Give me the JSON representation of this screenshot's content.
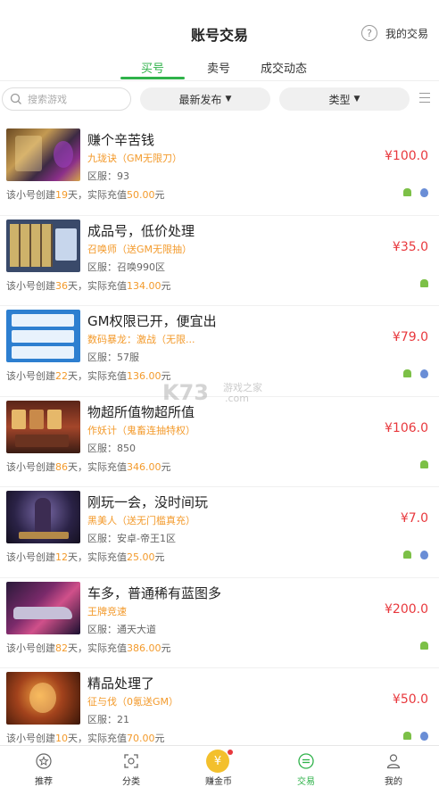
{
  "header": {
    "title": "账号交易",
    "my_trades": "我的交易",
    "help_glyph": "?"
  },
  "tabs": [
    {
      "label": "买号"
    },
    {
      "label": "卖号"
    },
    {
      "label": "成交动态"
    }
  ],
  "filters": {
    "search_placeholder": "搜索游戏",
    "sort_label": "最新发布",
    "type_label": "类型",
    "caret": "▼"
  },
  "listings": [
    {
      "name": "赚个辛苦钱",
      "game": "九珑诀（GM无限刀）",
      "server": "区服：93",
      "price": "¥100.0",
      "meta_prefix": "该小号创建",
      "days": "19",
      "meta_mid": "天，实际充值",
      "recharge": "50.00",
      "meta_suffix": "元",
      "android": true,
      "ios": true
    },
    {
      "name": "成品号，低价处理",
      "game": "召唤师（送GM无限抽）",
      "server": "区服：召唤990区",
      "price": "¥35.0",
      "meta_prefix": "该小号创建",
      "days": "36",
      "meta_mid": "天，实际充值",
      "recharge": "134.00",
      "meta_suffix": "元",
      "android": true,
      "ios": false
    },
    {
      "name": "GM权限已开，便宜出",
      "game": "数码暴龙：激战（无限...",
      "server": "区服：57服",
      "price": "¥79.0",
      "meta_prefix": "该小号创建",
      "days": "22",
      "meta_mid": "天，实际充值",
      "recharge": "136.00",
      "meta_suffix": "元",
      "android": true,
      "ios": true
    },
    {
      "name": "物超所值物超所值",
      "game": "作妖计（鬼畜连抽特权）",
      "server": "区服：850",
      "price": "¥106.0",
      "meta_prefix": "该小号创建",
      "days": "86",
      "meta_mid": "天，实际充值",
      "recharge": "346.00",
      "meta_suffix": "元",
      "android": true,
      "ios": false
    },
    {
      "name": "刚玩一会，没时间玩",
      "game": "黑美人（送无门槛真充）",
      "server": "区服：安卓-帝王1区",
      "price": "¥7.0",
      "meta_prefix": "该小号创建",
      "days": "12",
      "meta_mid": "天，实际充值",
      "recharge": "25.00",
      "meta_suffix": "元",
      "android": true,
      "ios": true
    },
    {
      "name": "车多，普通稀有蓝图多",
      "game": "王牌竞速",
      "server": "区服：通天大道",
      "price": "¥200.0",
      "meta_prefix": "该小号创建",
      "days": "82",
      "meta_mid": "天，实际充值",
      "recharge": "386.00",
      "meta_suffix": "元",
      "android": true,
      "ios": false
    },
    {
      "name": "精品处理了",
      "game": "征与伐（0氪送GM）",
      "server": "区服：21",
      "price": "¥50.0",
      "meta_prefix": "该小号创建",
      "days": "10",
      "meta_mid": "天，实际充值",
      "recharge": "70.00",
      "meta_suffix": "元",
      "android": true,
      "ios": true
    }
  ],
  "watermark": {
    "brand": "K73",
    "line1": "游戏之家",
    "line2": ".com"
  },
  "bottom_nav": [
    {
      "label": "推荐"
    },
    {
      "label": "分类"
    },
    {
      "label": "赚金币",
      "coin_glyph": "¥"
    },
    {
      "label": "交易"
    },
    {
      "label": "我的"
    }
  ],
  "colors": {
    "accent": "#2fb24a",
    "price": "#e8383d",
    "highlight": "#f39a2b"
  }
}
